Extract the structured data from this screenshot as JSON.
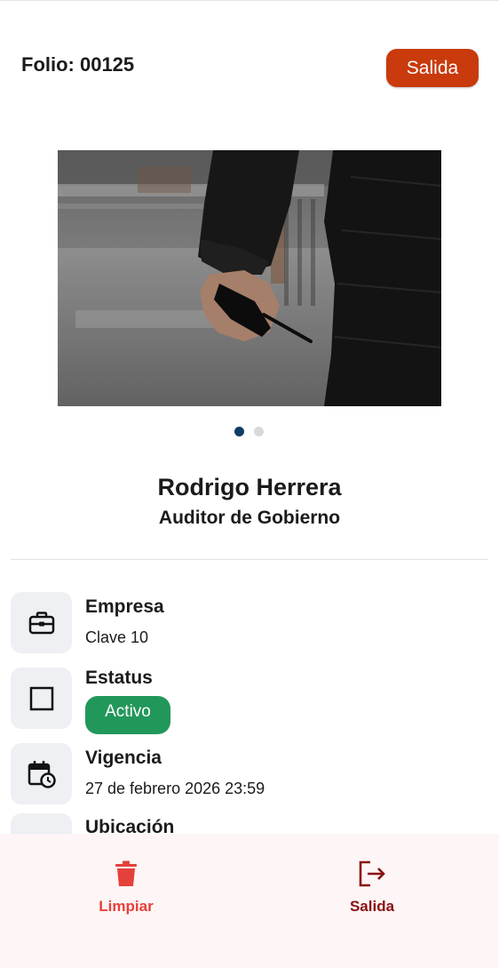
{
  "header": {
    "folio_text": "Folio: 00125",
    "exit_button_label": "Salida",
    "exit_button_color": "#c93a0c"
  },
  "carousel": {
    "image_description_icon": "photo",
    "total_pages": 2,
    "active_page": 1
  },
  "person": {
    "name": "Rodrigo Herrera",
    "role": "Auditor de Gobierno"
  },
  "details": {
    "empresa": {
      "icon": "briefcase-icon",
      "title": "Empresa",
      "value": "Clave 10"
    },
    "estatus": {
      "icon": "square-icon",
      "title": "Estatus",
      "badge": "Activo",
      "badge_color": "#22975a"
    },
    "vigencia": {
      "icon": "calendar-clock-icon",
      "title": "Vigencia",
      "value": "27 de febrero 2026 23:59"
    },
    "ubicacion": {
      "icon": "menu-icon",
      "title": "Ubicación"
    }
  },
  "bottom_nav": {
    "limpiar": {
      "icon": "trash-icon",
      "label": "Limpiar",
      "color": "#e5413b"
    },
    "salida": {
      "icon": "logout-icon",
      "label": "Salida",
      "color": "#8a1111"
    }
  }
}
